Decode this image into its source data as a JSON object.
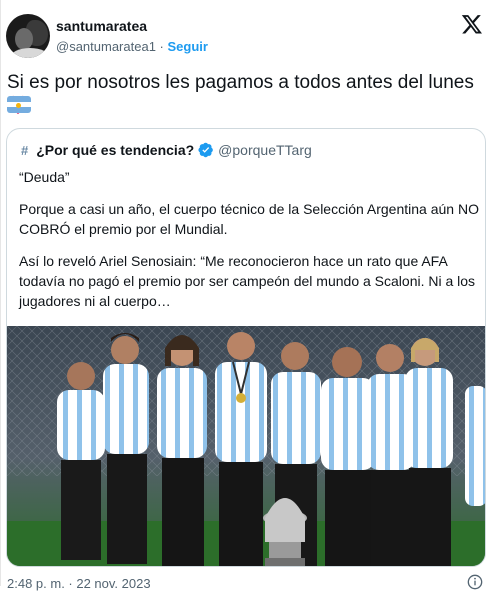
{
  "author": {
    "name": "santumaratea",
    "handle": "@santumaratea1",
    "separator": "·",
    "follow_label": "Seguir"
  },
  "tweet": {
    "text": "Si es por nosotros les pagamos a todos antes del lunes",
    "emojis": [
      "heart-icon",
      "argentina-flag-icon"
    ],
    "timestamp": "2:48 p. m. · 22 nov. 2023"
  },
  "quote": {
    "account_name": "¿Por qué es tendencia?",
    "account_handle": "@porqueTTarg",
    "hash_symbol": "#",
    "paragraphs": [
      "“Deuda”",
      "Porque a casi un año, el cuerpo técnico de la Selección Argentina aún NO COBRÓ el premio por el Mundial.",
      "Así lo reveló Ariel Senosiain: “Me reconocieron hace un rato que AFA todavía no pagó el premio por ser campeón del mundo a Scaloni. Ni a los jugadores ni al cuerpo…"
    ]
  },
  "colors": {
    "text": "#0f1419",
    "muted": "#536471",
    "accent": "#1d9bf0",
    "border": "#cfd9de",
    "heart": "#f91880",
    "flag_blue": "#74acdf"
  }
}
